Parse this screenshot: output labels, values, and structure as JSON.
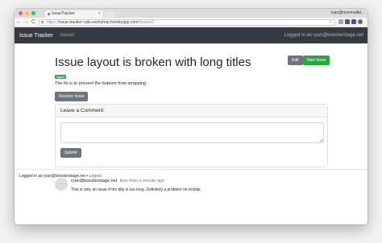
{
  "browser": {
    "tab_title": "IssueTracker",
    "tab_close": "×",
    "profile_label": "ryan@myemailid...",
    "url_scheme": "https://",
    "url_host": "issue-tracker-rails-workshop.herokuapp.com",
    "url_path": "/issues/2",
    "nav_back": "←",
    "nav_forward": "→",
    "nav_reload": "C",
    "star": "☆",
    "traffic_colors": [
      "#fc605b",
      "#fdbc40",
      "#34c84a"
    ]
  },
  "navbar": {
    "brand": "Issue Tracker",
    "issues_link": "Issues",
    "logged_in": "Logged in as ryan@boosterstage.net"
  },
  "issue": {
    "title": "Issue layout is broken with long titles",
    "status_badge": "Open",
    "description": "The fix is to prevent the buttons from wrapping.",
    "edit_label": "Edit",
    "new_issue_label": "New Issue",
    "resolve_label": "Resolve Issue"
  },
  "comment_form": {
    "header": "Leave a Comment:",
    "submit_label": "Submit"
  },
  "comments": [
    {
      "author": "ryan@boosterstage.net",
      "when": "less than a minute ago",
      "body": "This is only an issue if the title is too long. Definitely a problem on mobile."
    }
  ],
  "footer": {
    "logged_in": "Logged in as ryan@boosterstage.net •",
    "logout_label": "Logout"
  },
  "colors": {
    "navbar_bg": "#343a40",
    "success": "#28a745",
    "secondary": "#6c757d",
    "link": "#007bff"
  }
}
